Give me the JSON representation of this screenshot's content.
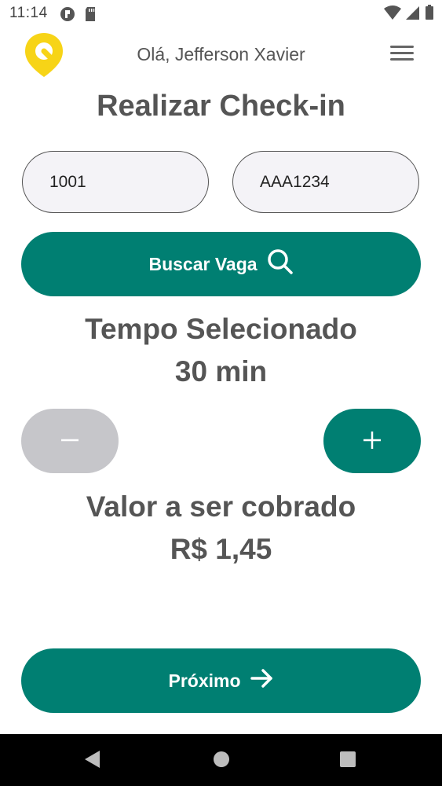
{
  "status_bar": {
    "time": "11:14"
  },
  "header": {
    "greeting": "Olá, Jefferson Xavier"
  },
  "page": {
    "title": "Realizar Check-in"
  },
  "form": {
    "vaga_value": "1001",
    "placa_value": "AAA1234"
  },
  "buttons": {
    "search_label": "Buscar Vaga",
    "next_label": "Próximo"
  },
  "time_section": {
    "title": "Tempo Selecionado",
    "value": "30 min"
  },
  "price_section": {
    "title": "Valor a ser cobrado",
    "value": "R$ 1,45"
  },
  "colors": {
    "primary": "#007f72",
    "disabled": "#c6c6ca",
    "logo_yellow": "#f7d417",
    "text": "#555555"
  },
  "icons": [
    "search-icon",
    "arrow-right-icon",
    "minus-icon",
    "plus-icon",
    "menu-icon",
    "back-icon",
    "home-icon",
    "recents-icon"
  ]
}
